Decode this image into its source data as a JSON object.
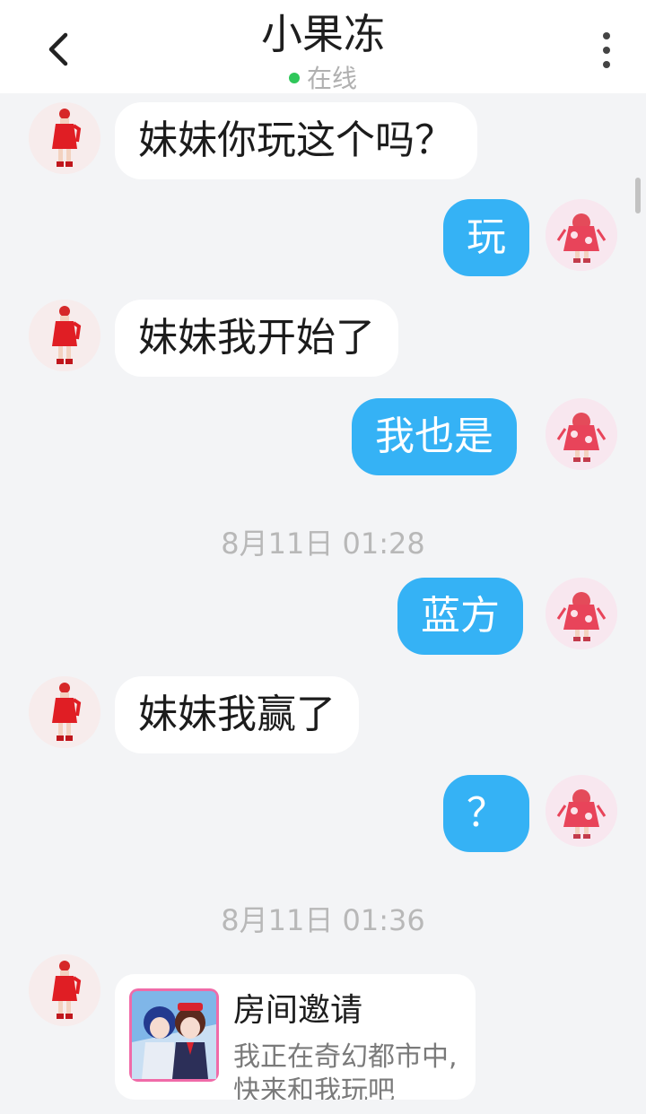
{
  "header": {
    "title": "小果冻",
    "status": "在线"
  },
  "messages": [
    {
      "side": "in",
      "text": "妹妹你玩这个吗？"
    },
    {
      "side": "out",
      "text": "玩"
    },
    {
      "side": "in",
      "text": "妹妹我开始了"
    },
    {
      "side": "out",
      "text": "我也是"
    },
    {
      "side": "out",
      "text": "蓝方"
    },
    {
      "side": "in",
      "text": "妹妹我赢了"
    },
    {
      "side": "out",
      "text": "？"
    }
  ],
  "timestamps": [
    "8月11日 01:28",
    "8月11日 01:36"
  ],
  "invite_card": {
    "title": "房间邀请",
    "description": "我正在奇幻都市中, 快来和我玩吧"
  },
  "colors": {
    "outgoing_bubble": "#35b2f5",
    "online_dot": "#2fc75a",
    "background": "#f3f4f6"
  }
}
